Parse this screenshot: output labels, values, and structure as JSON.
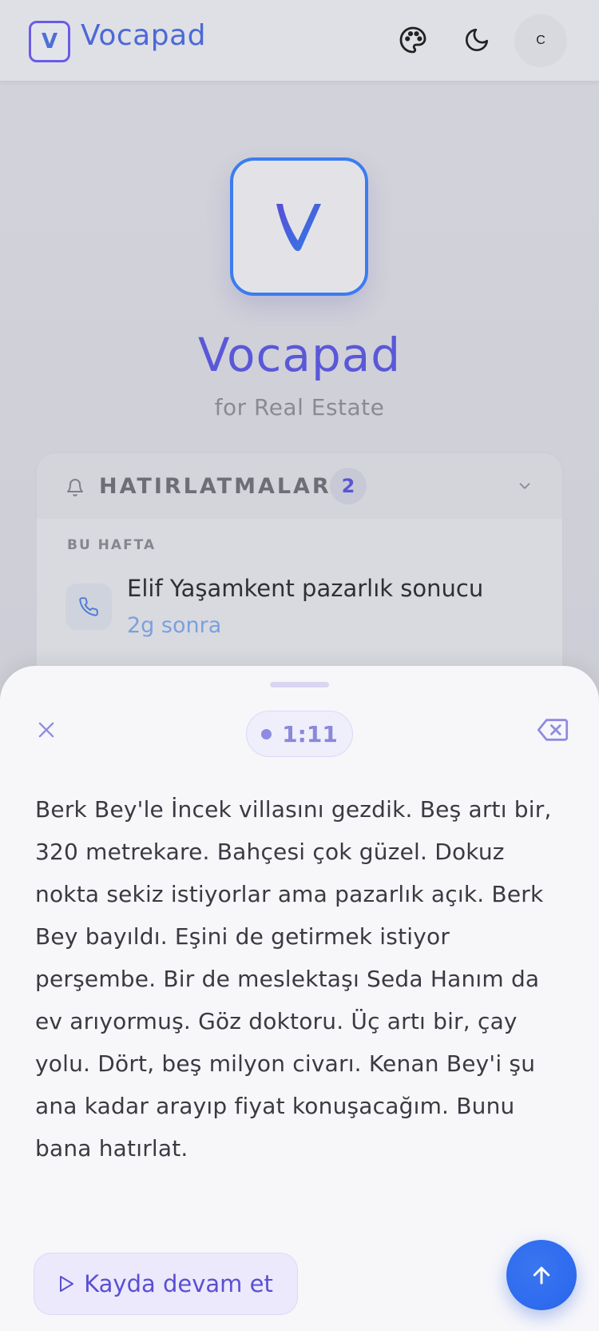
{
  "header": {
    "logo_letter": "V",
    "app_name": "Vocapad",
    "avatar_initial": "C",
    "icons": [
      "palette-icon",
      "moon-icon"
    ]
  },
  "hero": {
    "title": "Vocapad",
    "subtitle": "for Real Estate"
  },
  "reminders": {
    "title": "HATIRLATMALAR",
    "count": "2",
    "section_label": "BU HAFTA",
    "items": [
      {
        "title": "Elif Yaşamkent pazarlık sonucu",
        "time": "2g sonra",
        "icon": "phone-icon"
      }
    ]
  },
  "sheet": {
    "timer": "1:11",
    "transcript": "Berk Bey'le İncek villasını gezdik. Beş artı bir, 320 metrekare. Bahçesi çok güzel. Dokuz nokta sekiz istiyorlar ama pazarlık açık. Berk Bey bayıldı. Eşini de getirmek istiyor perşembe. Bir de meslektaşı Seda Hanım da ev arıyormuş. Göz doktoru. Üç artı bir, çay yolu. Dört, beş milyon civarı. Kenan Bey'i şu ana kadar arayıp fiyat konuşacağım. Bunu bana hatırlat.",
    "continue_label": "Kayda devam et"
  },
  "colors": {
    "accent": "#5a58d8",
    "primary_blue": "#2f6cf0",
    "reminder_time": "#7ba0de"
  }
}
